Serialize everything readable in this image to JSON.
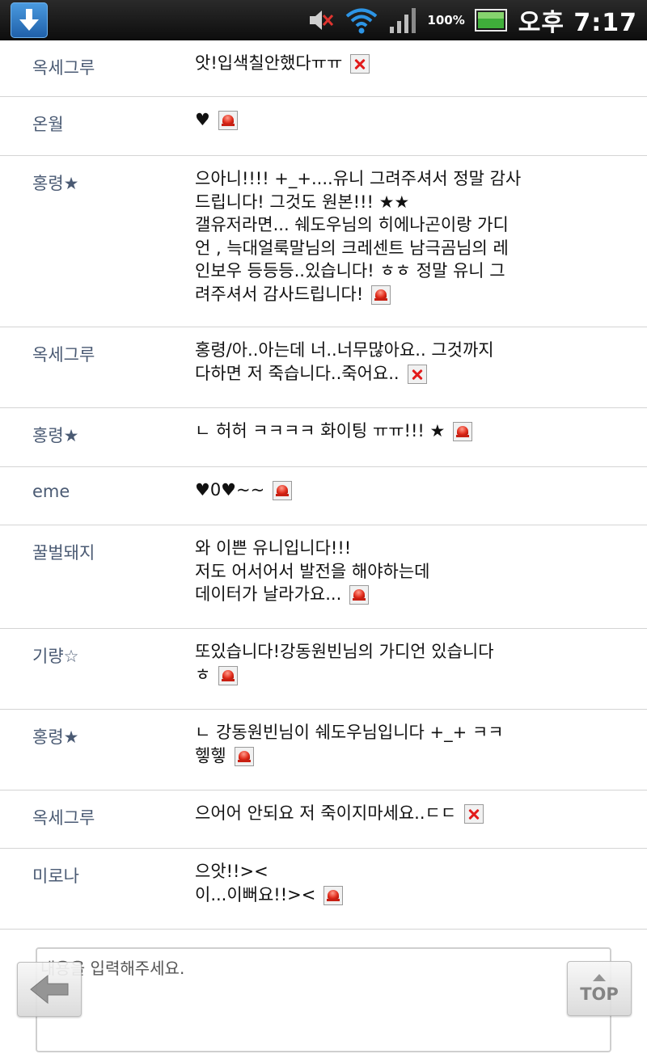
{
  "status_bar": {
    "battery_percent": "100%",
    "time": "오후 7:17",
    "icons": [
      "download-icon",
      "mute-icon",
      "wifi-icon",
      "signal-icon",
      "battery-icon"
    ]
  },
  "comments": [
    {
      "author": "옥세그루",
      "content": "앗!입색칠안했다ㅠㅠ",
      "action": "delete"
    },
    {
      "author": "온월",
      "content": "♥",
      "action": "report"
    },
    {
      "author": "홍령★",
      "content": "으아니!!!! +_+....유니 그려주셔서 정말 감사\n드립니다! 그것도 원본!!! ★★\n갤유저라면... 쉐도우님의 히에나곤이랑 가디\n언 , 늑대얼룩말님의 크레센트 남극곰님의 레\n인보우 등등등..있습니다! ㅎㅎ 정말 유니 그\n려주셔서 감사드립니다!",
      "action": "report"
    },
    {
      "author": "옥세그루",
      "content": "홍령/아..아는데 너..너무많아요.. 그것까지\n다하면 저 죽습니다..죽어요..",
      "action": "delete"
    },
    {
      "author": "홍령★",
      "content": "ㄴ 허허 ㅋㅋㅋㅋ 화이팅 ㅠㅠ!!! ★",
      "action": "report"
    },
    {
      "author": "eme",
      "content": "♥0♥~~",
      "action": "report"
    },
    {
      "author": "꿀벌돼지",
      "content": "와 이쁜 유니입니다!!!\n저도 어서어서 발전을 해야하는데\n데이터가 날라가요...",
      "action": "report"
    },
    {
      "author": "기량☆",
      "content": "또있습니다!강동원빈님의 가디언 있습니다\nㅎ",
      "action": "report"
    },
    {
      "author": "홍령★",
      "content": "ㄴ 강동원빈님이 쉐도우님입니다 +_+ ㅋㅋ\n헿헿",
      "action": "report"
    },
    {
      "author": "옥세그루",
      "content": "으어어 안되요 저 죽이지마세요..ㄷㄷ",
      "action": "delete"
    },
    {
      "author": "미로나",
      "content": "으앗!!><\n이...이뻐요!!><",
      "action": "report"
    }
  ],
  "compose": {
    "placeholder": "내용을 입력해주세요."
  },
  "buttons": {
    "top_label": "TOP"
  }
}
